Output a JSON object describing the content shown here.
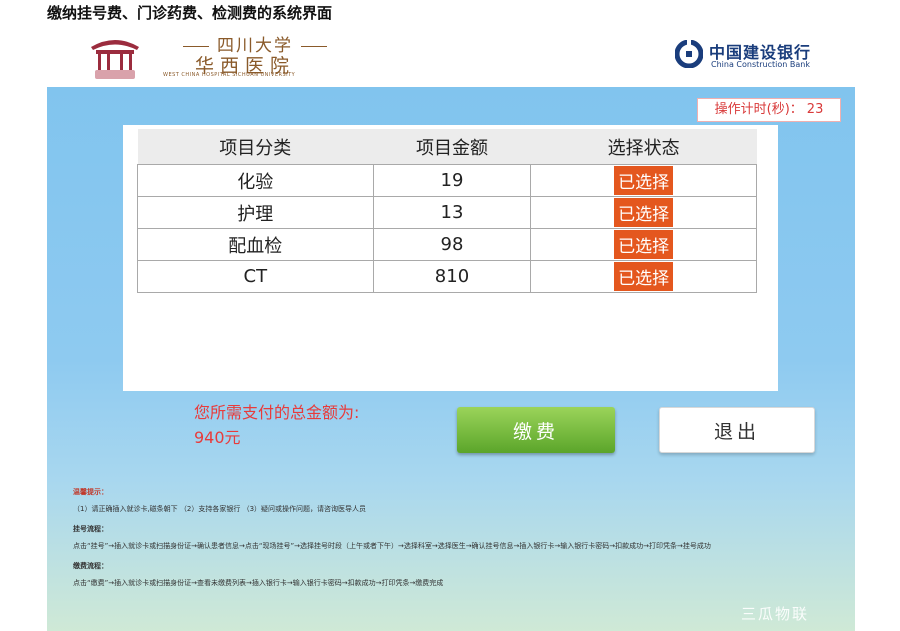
{
  "page_heading": "缴纳挂号费、门诊药费、检测费的系统界面",
  "hospital": {
    "name_top": "四川大学",
    "name_main": "华西医院",
    "name_en": "WEST CHINA HOSPITAL SICHUAN UNIVERSITY"
  },
  "bank": {
    "name_cn": "中国建设银行",
    "name_en": "China Construction Bank"
  },
  "timer": {
    "label": "操作计时(秒)：",
    "value": "23"
  },
  "table": {
    "headers": [
      "项目分类",
      "项目金额",
      "选择状态"
    ],
    "rows": [
      {
        "category": "化验",
        "amount": "19",
        "status": "已选择"
      },
      {
        "category": "护理",
        "amount": "13",
        "status": "已选择"
      },
      {
        "category": "配血检",
        "amount": "98",
        "status": "已选择"
      },
      {
        "category": "CT",
        "amount": "810",
        "status": "已选择"
      }
    ]
  },
  "total": {
    "label": "您所需支付的总金额为:",
    "value": "940元"
  },
  "buttons": {
    "pay": "缴费",
    "exit": "退出"
  },
  "tips": {
    "heading": "温馨提示：",
    "notice": "（1）请正确插入就诊卡,磁条朝下 （2）支持各家银行 （3）疑问或操作问题，请咨询医导人员",
    "registration_heading": "挂号流程：",
    "registration_steps": "点击“挂号”→插入就诊卡或扫描身份证→确认患者信息→点击“现场挂号”→选择挂号时段（上午或者下午）→选择科室→选择医生→确认挂号信息→插入银行卡→输入银行卡密码→扣款成功→打印凭条→挂号成功",
    "payment_heading": "缴费流程：",
    "payment_steps": "点击“缴费”→插入就诊卡或扫描身份证→查看未缴费列表→插入银行卡→输入银行卡密码→扣款成功→打印凭条→缴费完成"
  },
  "watermark": "三瓜物联",
  "colors": {
    "accent_red": "#e83b3b",
    "badge_orange": "#e4571e",
    "pay_green": "#6fb536",
    "bank_blue": "#1a3d7c"
  }
}
